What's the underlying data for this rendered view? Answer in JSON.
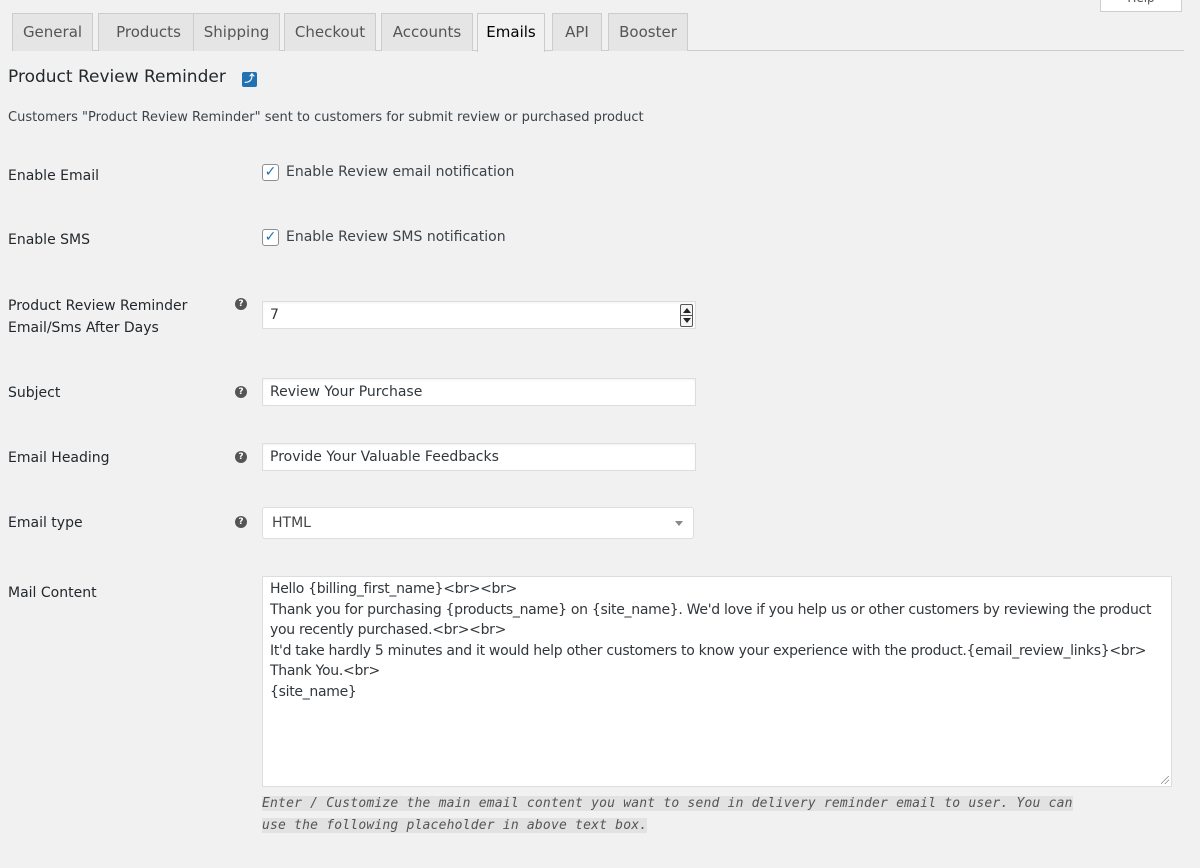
{
  "help_label": "Help",
  "tabs": [
    {
      "label": "General"
    },
    {
      "label": "Products"
    },
    {
      "label": "Shipping"
    },
    {
      "label": "Checkout"
    },
    {
      "label": "Accounts"
    },
    {
      "label": "Emails",
      "active": true
    },
    {
      "label": "API"
    },
    {
      "label": "Booster"
    }
  ],
  "section": {
    "title": "Product Review Reminder",
    "description": "Customers \"Product Review Reminder\" sent to customers for submit review or purchased product"
  },
  "fields": {
    "enable_email": {
      "label": "Enable Email",
      "checkbox_label": "Enable Review email notification",
      "checked": true
    },
    "enable_sms": {
      "label": "Enable SMS",
      "checkbox_label": "Enable Review SMS notification",
      "checked": true
    },
    "after_days": {
      "label_line1": "Product Review Reminder",
      "label_line2": "Email/Sms After Days",
      "value": "7"
    },
    "subject": {
      "label": "Subject",
      "value": "Review Your Purchase"
    },
    "email_heading": {
      "label": "Email Heading",
      "value": "Provide Your Valuable Feedbacks"
    },
    "email_type": {
      "label": "Email type",
      "value": "HTML"
    },
    "mail_content": {
      "label": "Mail Content",
      "lines": [
        "Hello {billing_first_name}<br><br>",
        "Thank you for purchasing {products_name} on {site_name}. We'd love if you help us or other customers by reviewing the product",
        "you recently purchased.<br><br>",
        "It'd take hardly 5 minutes and it would help other customers to know your experience with the product.{email_review_links}<br>",
        "Thank You.<br>",
        "{site_name}"
      ],
      "note_line1": "Enter / Customize the main email content you want to send in delivery reminder email to user. You can",
      "note_line2": "use the following placeholder in above text box."
    }
  },
  "colors": {
    "accent": "#2271b1",
    "background": "#f1f1f1"
  }
}
